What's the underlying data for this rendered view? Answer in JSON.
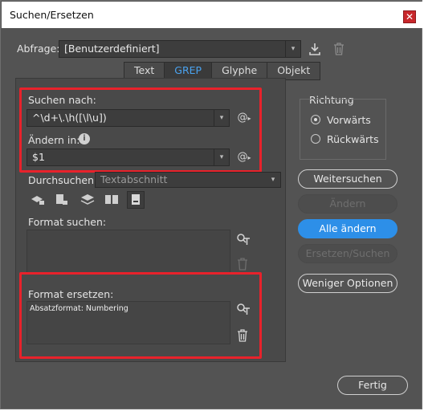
{
  "window": {
    "title": "Suchen/Ersetzen",
    "close_icon": "close-icon"
  },
  "query": {
    "label": "Abfrage:",
    "value": "[Benutzerdefiniert]"
  },
  "tabs": [
    {
      "label": "Text"
    },
    {
      "label": "GREP"
    },
    {
      "label": "Glyphe"
    },
    {
      "label": "Objekt"
    }
  ],
  "active_tab": "GREP",
  "search": {
    "label": "Suchen nach:",
    "value": "^\\d+\\.\\h([\\l\\u])"
  },
  "replace": {
    "label": "Ändern in:",
    "value": "$1"
  },
  "scope": {
    "label": "Durchsuchen:",
    "value": "Textabschnitt"
  },
  "format_search": {
    "label": "Format suchen:",
    "value": ""
  },
  "format_replace": {
    "label": "Format ersetzen:",
    "value": "Absatzformat: Numbering"
  },
  "direction": {
    "label": "Richtung",
    "forward": "Vorwärts",
    "backward": "Rückwärts",
    "selected": "Vorwärts"
  },
  "buttons": {
    "find_next": "Weitersuchen",
    "change": "Ändern",
    "change_all": "Alle ändern",
    "change_find": "Ersetzen/Suchen",
    "fewer_options": "Weniger Optionen",
    "done": "Fertig"
  },
  "colors": {
    "accent": "#2d8fe8",
    "highlight_box": "#e8222b",
    "background": "#535353"
  }
}
